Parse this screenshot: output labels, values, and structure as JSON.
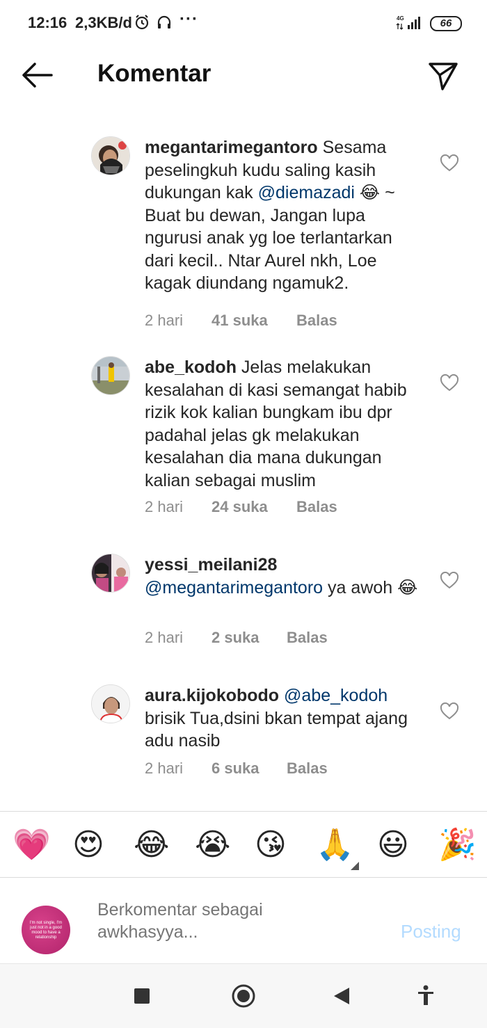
{
  "status_bar": {
    "time": "12:16",
    "speed": "2,3KB/d",
    "network": "4G",
    "battery": "66"
  },
  "header": {
    "title": "Komentar"
  },
  "comments": [
    {
      "username": "megantarimegantoro",
      "text_before": " Sesama peselingkuh kudu saling kasih dukungan kak ",
      "mention": "@diemazadi",
      "text_after": " 😂 ~ Buat bu dewan, Jangan lupa ngurusi anak yg loe terlantarkan dari kecil.. Ntar Aurel nkh, Loe kagak diundang ngamuk2.",
      "time": "2 hari",
      "likes": "41 suka",
      "reply": "Balas"
    },
    {
      "username": "abe_kodoh",
      "text_before": " Jelas melakukan kesalahan di kasi semangat habib rizik kok kalian bungkam ibu dpr padahal jelas gk melakukan kesalahan dia mana dukungan kalian sebagai muslim",
      "mention": "",
      "text_after": "",
      "time": "2 hari",
      "likes": "24 suka",
      "reply": "Balas"
    },
    {
      "username": "yessi_meilani28",
      "text_before": " ",
      "mention": "@megantarimegantoro",
      "text_after": " ya awoh 😂",
      "time": "2 hari",
      "likes": "2 suka",
      "reply": "Balas"
    },
    {
      "username": "aura.kijokobodo",
      "text_before": " ",
      "mention": "@abe_kodoh",
      "text_after": " brisik Tua,dsini bkan tempat ajang adu nasib",
      "time": "2 hari",
      "likes": "6 suka",
      "reply": "Balas"
    }
  ],
  "emoji_bar": [
    "💗",
    "😍",
    "😂",
    "😭",
    "😘",
    "🙏",
    "😃",
    "🎉"
  ],
  "composer": {
    "placeholder": "Berkomentar sebagai awkhasyya...",
    "post_label": "Posting",
    "avatar_text": "I'm not single, I'm just not in a good mood to have a relationship"
  },
  "colors": {
    "mention": "#00376b",
    "meta": "#8e8e8e",
    "post_disabled": "#b3dbff"
  }
}
